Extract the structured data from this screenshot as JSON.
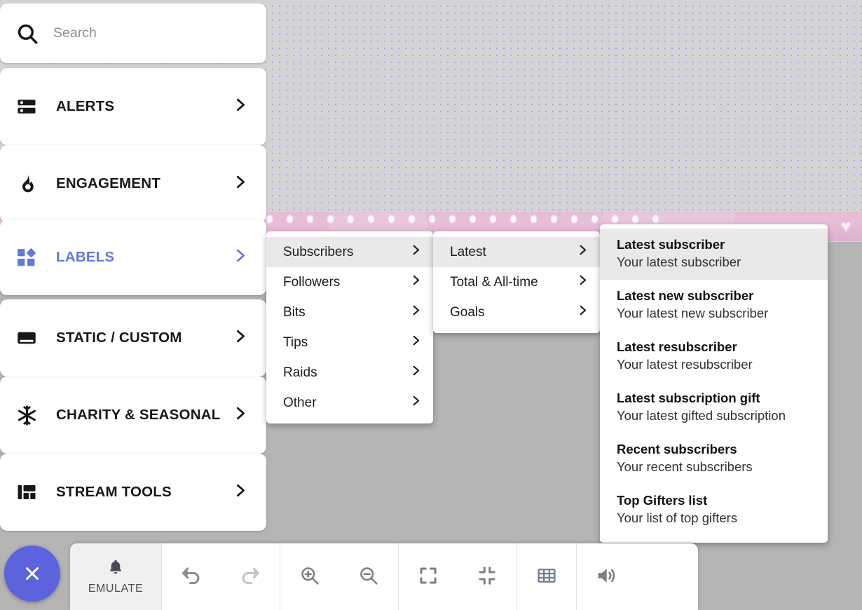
{
  "app": {
    "accent_blue": "#6478d8",
    "fab_purple": "#5c63dd",
    "canvas_dot_color": "#a9aadb",
    "selected_bg": "#e9e9e9"
  },
  "search": {
    "placeholder": "Search",
    "value": "",
    "icon": "search-icon"
  },
  "sidebar": {
    "items": [
      {
        "label": "ALERTS",
        "icon": "alerts-list-icon",
        "active": false
      },
      {
        "label": "ENGAGEMENT",
        "icon": "flame-icon",
        "active": false
      },
      {
        "label": "LABELS",
        "icon": "labels-shapes-icon",
        "active": true
      },
      {
        "label": "STATIC / CUSTOM",
        "icon": "card-icon",
        "active": false
      },
      {
        "label": "CHARITY & SEASONAL",
        "icon": "snowflake-icon",
        "active": false
      },
      {
        "label": "STREAM TOOLS",
        "icon": "layout-grid-icon",
        "active": false
      }
    ],
    "chevron_icon": "chevron-right-icon"
  },
  "menus": {
    "level1": {
      "items": [
        {
          "label": "Subscribers",
          "selected": true
        },
        {
          "label": "Followers",
          "selected": false
        },
        {
          "label": "Bits",
          "selected": false
        },
        {
          "label": "Tips",
          "selected": false
        },
        {
          "label": "Raids",
          "selected": false
        },
        {
          "label": "Other",
          "selected": false
        }
      ]
    },
    "level2": {
      "items": [
        {
          "label": "Latest",
          "selected": true
        },
        {
          "label": "Total & All-time",
          "selected": false
        },
        {
          "label": "Goals",
          "selected": false
        }
      ]
    },
    "level3": {
      "items": [
        {
          "title": "Latest subscriber",
          "subtitle": "Your latest subscriber",
          "selected": true
        },
        {
          "title": "Latest new subscriber",
          "subtitle": "Your latest new subscriber",
          "selected": false
        },
        {
          "title": "Latest resubscriber",
          "subtitle": "Your latest resubscriber",
          "selected": false
        },
        {
          "title": "Latest subscription gift",
          "subtitle": "Your latest gifted subscription",
          "selected": false
        },
        {
          "title": "Recent subscribers",
          "subtitle": "Your recent subscribers",
          "selected": false
        },
        {
          "title": "Top Gifters list",
          "subtitle": "Your list of top gifters",
          "selected": false
        }
      ]
    }
  },
  "canvas": {
    "widget": {
      "name": "pink-banner-widget",
      "icon": "heart-icon",
      "heart_glyph": "♥"
    }
  },
  "bottom_bar": {
    "close_button": {
      "icon": "close-x-icon"
    },
    "emulate": {
      "label": "EMULATE",
      "icon": "bell-icon",
      "active": true
    },
    "tools": [
      {
        "name": "undo-button",
        "icon": "undo-arrow-icon",
        "disabled": false
      },
      {
        "name": "redo-button",
        "icon": "redo-arrow-icon",
        "disabled": true
      },
      {
        "name": "zoom-in-button",
        "icon": "zoom-in-icon",
        "disabled": false
      },
      {
        "name": "zoom-out-button",
        "icon": "zoom-out-icon",
        "disabled": false
      },
      {
        "name": "expand-button",
        "icon": "expand-fullscreen-icon",
        "disabled": false
      },
      {
        "name": "collapse-button",
        "icon": "collapse-icon",
        "disabled": false
      },
      {
        "name": "grid-toggle-button",
        "icon": "grid-icon",
        "disabled": false
      },
      {
        "name": "volume-button",
        "icon": "speaker-volume-icon",
        "disabled": false
      }
    ]
  }
}
